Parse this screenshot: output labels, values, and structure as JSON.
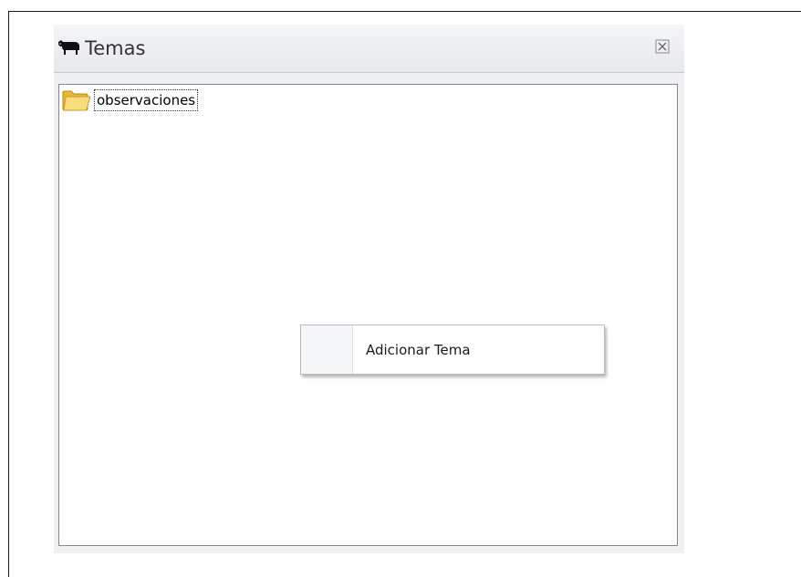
{
  "window": {
    "title": "Temas",
    "title_icon": "cow-icon",
    "close_icon": "close-icon"
  },
  "tree": {
    "nodes": [
      {
        "label": "observaciones",
        "icon": "folder-icon"
      }
    ]
  },
  "context_menu": {
    "items": [
      {
        "label": "Adicionar Tema"
      }
    ]
  },
  "colors": {
    "panel_bg": "#eef0f2",
    "tree_border": "#828790",
    "folder_fill": "#f7d774"
  }
}
